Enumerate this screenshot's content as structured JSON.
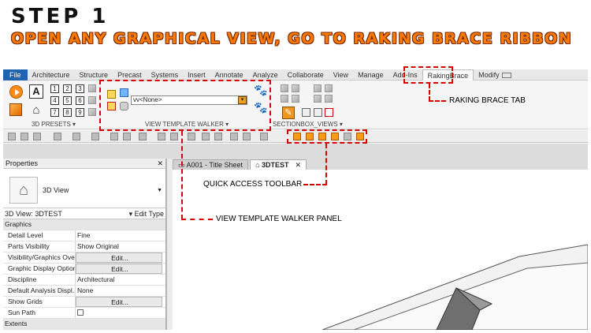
{
  "header": {
    "step": "STEP 1",
    "subtitle": "OPEN ANY GRAPHICAL VIEW, GO TO RAKING BRACE RIBBON"
  },
  "tabs": [
    {
      "label": "File"
    },
    {
      "label": "Architecture"
    },
    {
      "label": "Structure"
    },
    {
      "label": "Precast"
    },
    {
      "label": "Systems"
    },
    {
      "label": "Insert"
    },
    {
      "label": "Annotate"
    },
    {
      "label": "Analyze"
    },
    {
      "label": "Collaborate"
    },
    {
      "label": "View"
    },
    {
      "label": "Manage"
    },
    {
      "label": "Add-Ins"
    },
    {
      "label": "RakingBrace"
    },
    {
      "label": "Modify"
    }
  ],
  "ribbon": {
    "presets_label": "3D PRESETS",
    "numbers": [
      "1",
      "2",
      "3",
      "4",
      "5",
      "6",
      "7",
      "8",
      "9"
    ],
    "vtw_select_value": "vv<None>",
    "vtw_label": "VIEW TEMPLATE WALKER",
    "sectionbox_label": "SECTIONBOX_VIEWS"
  },
  "annotations": {
    "raking_tab": "RAKING BRACE TAB",
    "qat": "QUICK ACCESS TOOLBAR",
    "vtw_panel": "VIEW TEMPLATE WALKER PANEL"
  },
  "properties": {
    "title": "Properties",
    "type_name": "3D View",
    "view_selector": "3D View: 3DTEST",
    "edit_type": "Edit Type",
    "groups": {
      "graphics": "Graphics",
      "extents": "Extents"
    },
    "rows": [
      {
        "key": "Detail Level",
        "value": "Fine"
      },
      {
        "key": "Parts Visibility",
        "value": "Show Original"
      },
      {
        "key": "Visibility/Graphics Ove...",
        "value": "Edit..."
      },
      {
        "key": "Graphic Display Options",
        "value": "Edit..."
      },
      {
        "key": "Discipline",
        "value": "Architectural"
      },
      {
        "key": "Default Analysis Displ...",
        "value": "None"
      },
      {
        "key": "Show Grids",
        "value": "Edit..."
      },
      {
        "key": "Sun Path",
        "value": ""
      }
    ]
  },
  "doc_tabs": [
    {
      "label": "A001 - Title Sheet"
    },
    {
      "label": "3DTEST"
    }
  ],
  "colors": {
    "accent_orange": "#ff7a00",
    "annotation_red": "#d60000",
    "file_tab_blue": "#1e62b0"
  },
  "icons": [
    "play-icon",
    "letter-a-icon",
    "house-icon",
    "cube-icon",
    "paw-icon",
    "wrench-icon",
    "save-icon",
    "undo-icon",
    "redo-icon",
    "print-icon",
    "close-icon"
  ]
}
